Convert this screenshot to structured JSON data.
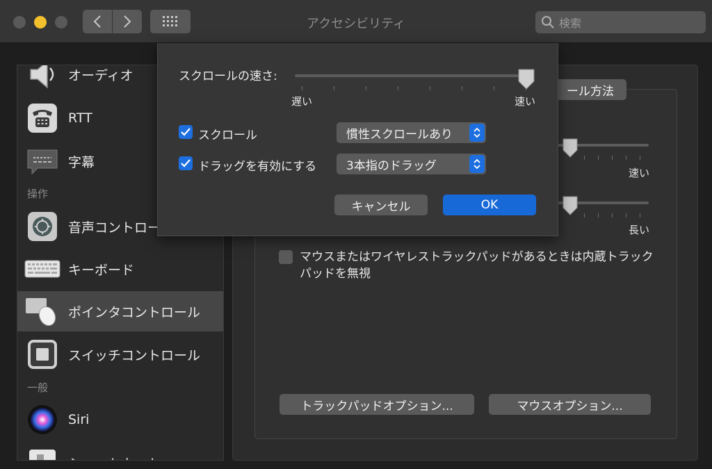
{
  "window": {
    "title": "アクセシビリティ",
    "search_placeholder": "検索"
  },
  "sidebar": {
    "items": [
      {
        "label": "オーディオ",
        "icon": "speaker-icon"
      },
      {
        "label": "RTT",
        "icon": "telephone-icon"
      },
      {
        "label": "字幕",
        "icon": "captions-icon"
      },
      {
        "label": "音声コントロール",
        "icon": "voice-control-icon"
      },
      {
        "label": "キーボード",
        "icon": "keyboard-icon"
      },
      {
        "label": "ポインタコントロール",
        "icon": "pointer-control-icon",
        "selected": true
      },
      {
        "label": "スイッチコントロール",
        "icon": "switch-control-icon"
      },
      {
        "label": "Siri",
        "icon": "siri-icon"
      },
      {
        "label": "ショートカット",
        "icon": "shortcut-icon"
      }
    ],
    "sections": {
      "operation": "操作",
      "general": "一般"
    }
  },
  "main": {
    "tab_label": "ール方法",
    "slider_fast_label": "速い",
    "slider_long_label": "長い",
    "ignore_trackpad_text": "マウスまたはワイヤレストラックパッドがあるときは内蔵トラックパッドを無視",
    "ignore_trackpad_checked": false,
    "trackpad_options_button": "トラックパッドオプション...",
    "mouse_options_button": "マウスオプション..."
  },
  "dialog": {
    "scroll_speed_label": "スクロールの速さ:",
    "scroll_speed_value": 1.0,
    "slow_label": "遅い",
    "fast_label": "速い",
    "scroll_checkbox_label": "スクロール",
    "scroll_checked": true,
    "scroll_mode_selected": "慣性スクロールあり",
    "drag_checkbox_label": "ドラッグを有効にする",
    "drag_checked": true,
    "drag_mode_selected": "3本指のドラッグ",
    "cancel_button": "キャンセル",
    "ok_button": "OK"
  },
  "colors": {
    "accent": "#1d6fe0",
    "close_inactive": "#595959",
    "minimize": "#f2c02c"
  }
}
